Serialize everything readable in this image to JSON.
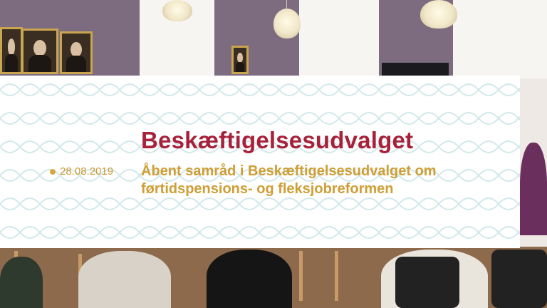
{
  "committee": {
    "title": "Beskæftigelsesudvalget",
    "date": "28.08.2019",
    "subtitle": "Åbent samråd i Beskæftigelsesudvalget om førtidspensions- og fleksjobreformen"
  },
  "colors": {
    "title": "#a8213a",
    "accent": "#cf9e35",
    "pattern": "#d7ecee",
    "card_background": "#ffffff"
  }
}
